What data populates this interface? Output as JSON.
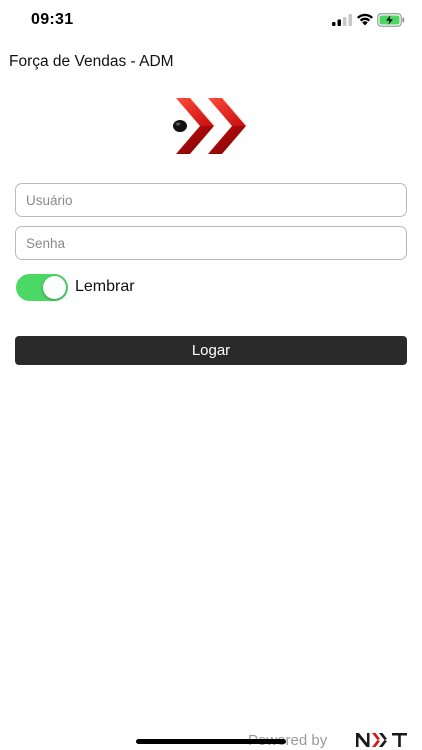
{
  "status_bar": {
    "time": "09:31",
    "signal_icon": "cellular-signal-icon",
    "wifi_icon": "wifi-icon",
    "battery_icon": "battery-charging-icon",
    "battery_color": "#4cd864"
  },
  "header": {
    "title": "Força de Vendas - ADM"
  },
  "logo": {
    "icon": "double-chevron-logo-icon",
    "primary_color": "#d81414"
  },
  "form": {
    "username": {
      "value": "",
      "placeholder": "Usuário"
    },
    "password": {
      "value": "",
      "placeholder": "Senha"
    },
    "remember": {
      "label": "Lembrar",
      "on": true,
      "on_color": "#4cd864"
    },
    "login_label": "Logar",
    "login_color": "#2a2a2a"
  },
  "footer": {
    "powered_by": "Powered by",
    "brand_logo_text": "NXT"
  }
}
